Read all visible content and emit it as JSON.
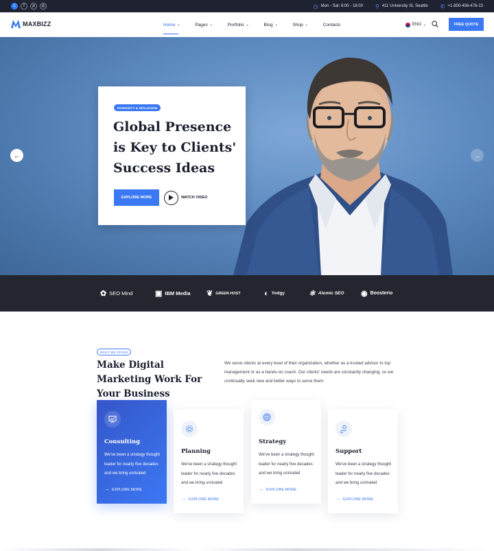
{
  "topbar": {
    "socials": [
      {
        "icon": "twitter-icon",
        "glyph": "t"
      },
      {
        "icon": "facebook-icon",
        "glyph": "f"
      },
      {
        "icon": "pinterest-icon",
        "glyph": "p"
      },
      {
        "icon": "instagram-icon",
        "glyph": "◎"
      }
    ],
    "hours": "Mon - Sat: 8:00 - 18:00",
    "address": "411 University St, Seattle",
    "phone": "+1-800-456-478-23"
  },
  "nav": {
    "logo": "MAXBIZZ",
    "menu": [
      {
        "label": "Home",
        "active": true,
        "has_caret": true
      },
      {
        "label": "Pages",
        "active": false,
        "has_caret": true
      },
      {
        "label": "Portfolio",
        "active": false,
        "has_caret": true
      },
      {
        "label": "Blog",
        "active": false,
        "has_caret": true
      },
      {
        "label": "Shop",
        "active": false,
        "has_caret": true
      },
      {
        "label": "Contacts",
        "active": false,
        "has_caret": false
      }
    ],
    "language": "ENG",
    "quote_button": "FREE QUOTE"
  },
  "hero": {
    "badge": "DIVERSITY & INCLUSION",
    "title": "Global Presence is Key to Clients' Success Ideas",
    "explore_button": "EXPLORE MORE",
    "watch_label": "WATCH VIDEO"
  },
  "brands": [
    {
      "name": "SEO Mind",
      "icon": "seo-mind-icon",
      "glyph": "✿"
    },
    {
      "name": "IBM Media",
      "icon": "ibm-media-icon",
      "glyph": "▣"
    },
    {
      "name": "GREEN HOST",
      "icon": "green-host-icon",
      "glyph": "❦"
    },
    {
      "name": "Yodgy",
      "icon": "yodgy-icon",
      "glyph": "◐"
    },
    {
      "name": "Atomic SEO",
      "icon": "atomic-seo-icon",
      "glyph": "⚛"
    },
    {
      "name": "Boosterio",
      "icon": "boosterio-icon",
      "glyph": "◉"
    }
  ],
  "services": {
    "tag": "WHAT WE OFFER",
    "title": "Make Digital Marketing Work For Your Business",
    "description": "We serve clients at every level of their organization, whether as a trusted advisor to top management or as a hands-on coach. Our clients' needs are constantly changing, so we continually seek new and better ways to serve them.",
    "cards": [
      {
        "title": "Consulting",
        "text": "We've been a strategy thought leader for nearly five decades and we bring unrivaled",
        "link": "EXPLORE MORE",
        "icon": "presentation-board-icon",
        "featured": true
      },
      {
        "title": "Planning",
        "text": "We've been a strategy thought leader for nearly five decades and we bring unrivaled",
        "link": "EXPLORE MORE",
        "icon": "gear-cycle-icon",
        "featured": false
      },
      {
        "title": "Strategy",
        "text": "We've been a strategy thought leader for nearly five decades and we bring unrivaled",
        "link": "EXPLORE MORE",
        "icon": "target-icon",
        "featured": false
      },
      {
        "title": "Support",
        "text": "We've been a strategy thought leader for nearly five decades and we bring unrivaled",
        "link": "EXPLORE MORE",
        "icon": "hand-money-icon",
        "featured": false
      }
    ]
  },
  "colors": {
    "accent": "#3b78f4",
    "dark": "#1f2230",
    "brand_strip": "#24262f"
  }
}
